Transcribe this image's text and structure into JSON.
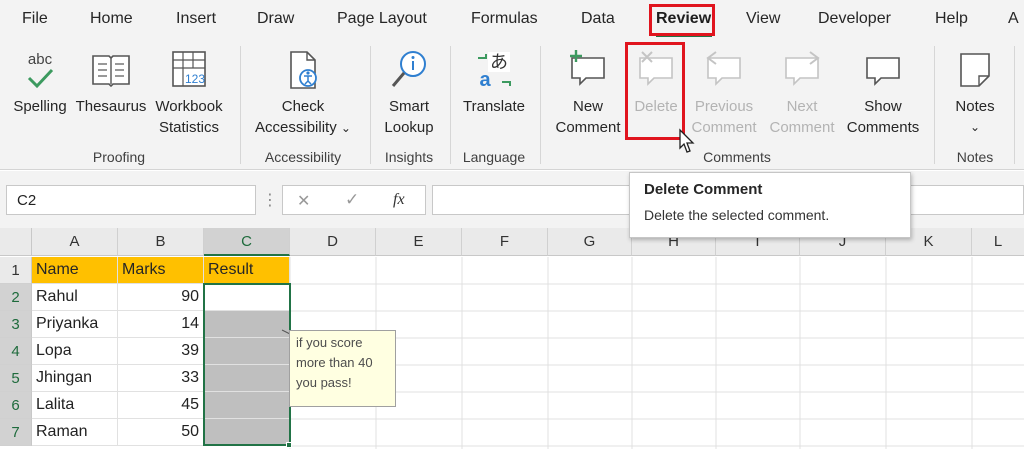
{
  "menu": {
    "items": [
      "File",
      "Home",
      "Insert",
      "Draw",
      "Page Layout",
      "Formulas",
      "Data",
      "Review",
      "View",
      "Developer",
      "Help",
      "A"
    ],
    "active": "Review"
  },
  "ribbon": {
    "proofing": {
      "label": "Proofing",
      "spelling": "Spelling",
      "thesaurus": "Thesaurus",
      "workbook_stats_l1": "Workbook",
      "workbook_stats_l2": "Statistics",
      "abc": "abc",
      "stats_num": "123"
    },
    "accessibility": {
      "label": "Accessibility",
      "check_l1": "Check",
      "check_l2": "Accessibility",
      "chevron": "⌄"
    },
    "insights": {
      "label": "Insights",
      "smart_l1": "Smart",
      "smart_l2": "Lookup"
    },
    "language": {
      "label": "Language",
      "translate": "Translate"
    },
    "comments": {
      "label": "Comments",
      "new_l1": "New",
      "new_l2": "Comment",
      "delete": "Delete",
      "previous_l1": "Previous",
      "previous_l2": "Comment",
      "next_l1": "Next",
      "next_l2": "Comment",
      "show_l1": "Show",
      "show_l2": "Comments"
    },
    "notes": {
      "label": "Notes",
      "notes": "Notes",
      "chevron": "⌄"
    }
  },
  "formula_bar": {
    "name_box": "C2",
    "dots": "⋮",
    "cancel": "✕",
    "enter": "✓",
    "fx": "fx",
    "formula": ""
  },
  "tooltip": {
    "title": "Delete Comment",
    "description": "Delete the selected comment."
  },
  "grid": {
    "columns": [
      "A",
      "B",
      "C",
      "D",
      "E",
      "F",
      "G",
      "H",
      "I",
      "J",
      "K",
      "L"
    ],
    "rows": [
      "1",
      "2",
      "3",
      "4",
      "5",
      "6",
      "7"
    ],
    "headers": [
      "Name",
      "Marks",
      "Result"
    ],
    "data": [
      [
        "Rahul",
        "90"
      ],
      [
        "Priyanka",
        "14"
      ],
      [
        "Lopa",
        "39"
      ],
      [
        "Jhingan",
        "33"
      ],
      [
        "Lalita",
        "45"
      ],
      [
        "Raman",
        "50"
      ]
    ]
  },
  "comment_note": {
    "line1": "if you score",
    "line2": "more than 40",
    "line3": "you pass!"
  },
  "colors": {
    "accent_green": "#217346",
    "highlight_red": "#e0141e",
    "header_fill": "#ffc000",
    "comment_fill": "#ffffe1"
  }
}
